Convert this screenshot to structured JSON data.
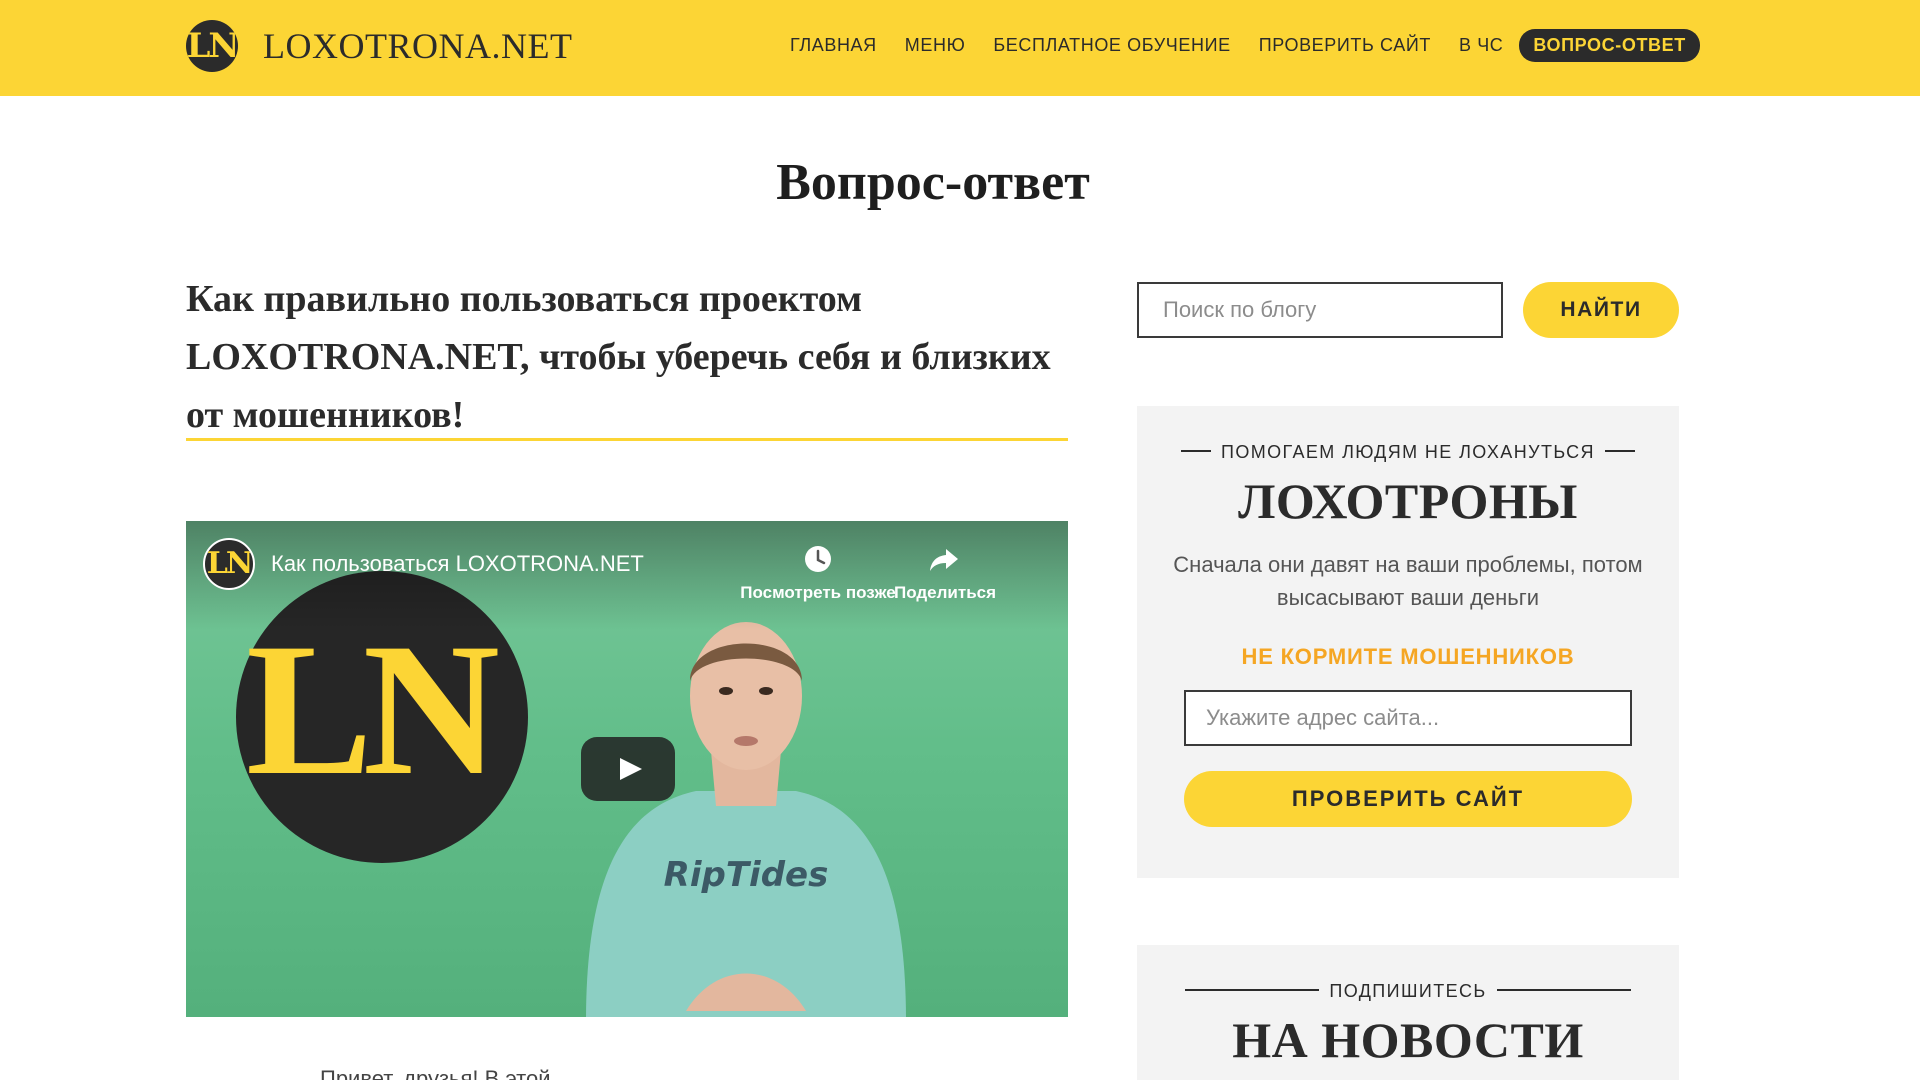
{
  "header": {
    "logo_mark": "LN",
    "logo_text": "LOXOTRONA.NET",
    "nav": [
      {
        "label": "ГЛАВНАЯ"
      },
      {
        "label": "МЕНЮ"
      },
      {
        "label": "БЕСПЛАТНОЕ ОБУЧЕНИЕ"
      },
      {
        "label": "ПРОВЕРИТЬ САЙТ"
      },
      {
        "label": "В ЧС"
      },
      {
        "label": "ВОПРОС-ОТВЕТ",
        "active": true
      }
    ]
  },
  "page_title": "Вопрос-ответ",
  "article": {
    "title": "Как правильно пользоваться проектом LOXOTRONA.NET, чтобы уберечь себя и близких от мошенников!",
    "video": {
      "channel_avatar": "LN",
      "title": "Как пользоваться LOXOTRONA.NET",
      "watch_later": "Посмотреть позже",
      "share": "Поделиться",
      "big_logo": "LN",
      "shirt_text": "RipTides"
    },
    "teaser": "Привет, друзья! В этой"
  },
  "sidebar": {
    "search": {
      "placeholder": "Поиск по блогу",
      "button": "НАЙТИ"
    },
    "widget_scams": {
      "kicker": "ПОМОГАЕМ ЛЮДЯМ НЕ ЛОХАНУТЬСЯ",
      "heading": "ЛОХОТРОНЫ",
      "text": "Сначала они давят на ваши проблемы, потом высасывают ваши деньги",
      "accent": "НЕ КОРМИТЕ МОШЕННИКОВ",
      "input_placeholder": "Укажите адрес сайта...",
      "button": "ПРОВЕРИТЬ САЙТ"
    },
    "widget_subscribe": {
      "kicker": "ПОДПИШИТЕСЬ",
      "heading": "НА НОВОСТИ"
    }
  },
  "colors": {
    "brand_yellow": "#fcd535",
    "dark": "#2b2b2b",
    "accent_orange": "#f5a623",
    "video_green": "#62be8a"
  }
}
